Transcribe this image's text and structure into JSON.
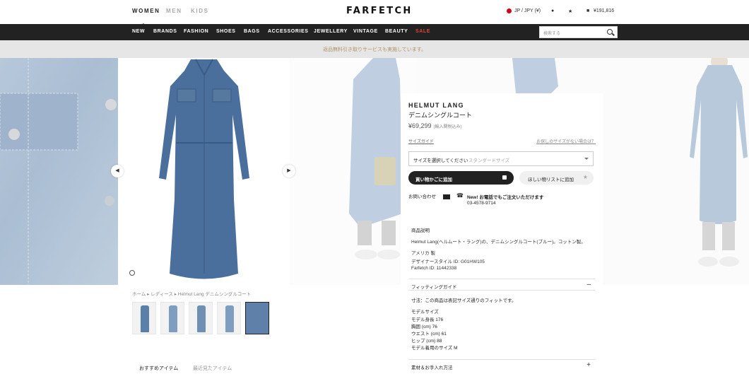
{
  "header": {
    "genders": [
      "WOMEN",
      "MEN",
      "KIDS"
    ],
    "logo": "FARFETCH",
    "region": "JP / JPY (¥)",
    "bag_total": "¥191,816"
  },
  "nav": {
    "items": [
      "NEW",
      "BRANDS",
      "FASHION",
      "SHOES",
      "BAGS",
      "ACCESSORIES",
      "JEWELLERY",
      "VINTAGE",
      "BEAUTY",
      "SALE"
    ],
    "search_placeholder": "検索する"
  },
  "promo": "返品無料引き取りサービスも実施しています。",
  "product": {
    "brand": "HELMUT LANG",
    "name": "デニムシングルコート",
    "price": "¥69,299",
    "price_note": "(輸入関税込み)",
    "size_guide": "サイズガイド",
    "size_help": "お探しのサイズがない場合は？",
    "size_select_label": "サイズを選択してください",
    "size_select_value": "スタンダードサイズ",
    "add_to_bag": "買い物かごに追加",
    "add_to_wishlist": "ほしい物リストに追加",
    "contact_label": "お問い合わせ",
    "phone_title": "New! お電話でもご注文いただけます",
    "phone_number": "03-4578-9714",
    "details_heading": "商品説明",
    "details": "Helmut Lang(ヘルムート・ラング)の、デニムシングルコート(ブルー)。コットン製。",
    "origin": "アメリカ 製",
    "designer_style": "デザイナースタイル ID: G01HW105",
    "farfetch_id": "Farfetch ID: 11442338",
    "fitting_title": "フィッティングガイド",
    "fitting_note": "寸法：この商品は表記サイズ通りのフィットです。",
    "model_heading": "モデルサイズ",
    "model_lines": [
      "モデル身長 176",
      "胸囲 (cm) 76",
      "ウエスト (cm) 61",
      "ヒップ (cm) 88",
      "モデル着用のサイズ M"
    ],
    "care_title": "素材＆お手入れ方法"
  },
  "breadcrumb": "ホーム ▸ レディース ▸ Helmut Lang デニムシングルコート",
  "recommend_tabs": [
    "おすすめアイテム",
    "最近見たアイテム"
  ]
}
